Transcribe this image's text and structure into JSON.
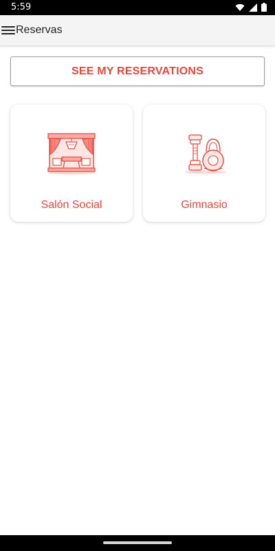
{
  "status_bar": {
    "time": "5:59",
    "icons": [
      "wifi-icon",
      "signal-icon",
      "battery-icon"
    ]
  },
  "app_bar": {
    "title": "Reservas",
    "menu_icon": "hamburger-menu-icon"
  },
  "main": {
    "reservations_button": "SEE MY RESERVATIONS",
    "amenities": [
      {
        "label": "Salón Social",
        "icon": "social-hall-icon"
      },
      {
        "label": "Gimnasio",
        "icon": "gym-dumbbell-kettlebell-icon"
      }
    ]
  },
  "colors": {
    "accent": "#e8463b",
    "app_bar_bg": "#f4f4f4",
    "status_bar_bg": "#000000"
  }
}
